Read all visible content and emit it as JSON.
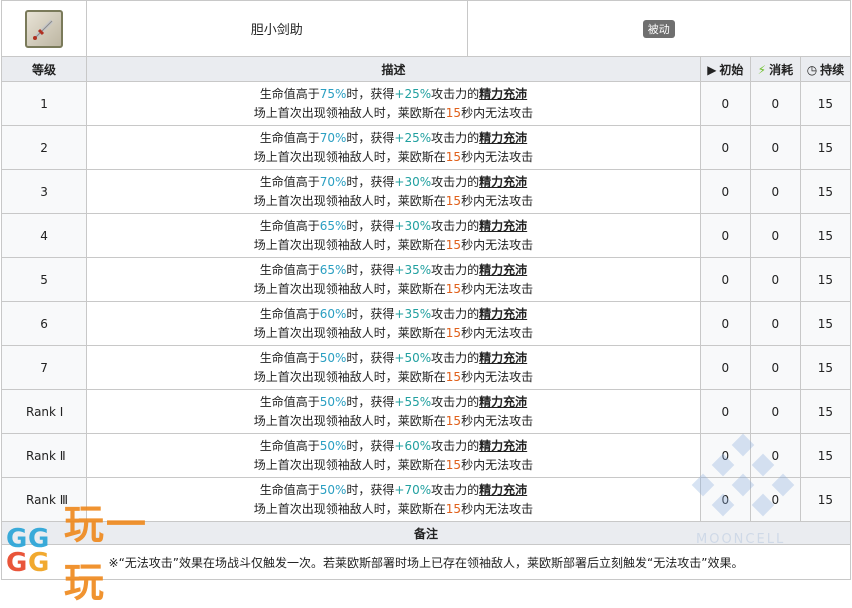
{
  "skill": {
    "name": "胆小剑助",
    "type_badge": "被动",
    "icon": "sword-skill-icon"
  },
  "columns": {
    "level": "等级",
    "description": "描述",
    "initial": "初始",
    "cost": "消耗",
    "duration": "持续"
  },
  "rows": [
    {
      "level": "1",
      "hp": "75%",
      "atk": "+25%",
      "initial": "0",
      "cost": "0",
      "duration": "15"
    },
    {
      "level": "2",
      "hp": "70%",
      "atk": "+25%",
      "initial": "0",
      "cost": "0",
      "duration": "15"
    },
    {
      "level": "3",
      "hp": "70%",
      "atk": "+30%",
      "initial": "0",
      "cost": "0",
      "duration": "15"
    },
    {
      "level": "4",
      "hp": "65%",
      "atk": "+30%",
      "initial": "0",
      "cost": "0",
      "duration": "15"
    },
    {
      "level": "5",
      "hp": "65%",
      "atk": "+35%",
      "initial": "0",
      "cost": "0",
      "duration": "15"
    },
    {
      "level": "6",
      "hp": "60%",
      "atk": "+35%",
      "initial": "0",
      "cost": "0",
      "duration": "15"
    },
    {
      "level": "7",
      "hp": "50%",
      "atk": "+50%",
      "initial": "0",
      "cost": "0",
      "duration": "15"
    },
    {
      "level": "Rank Ⅰ",
      "hp": "50%",
      "atk": "+55%",
      "initial": "0",
      "cost": "0",
      "duration": "15"
    },
    {
      "level": "Rank Ⅱ",
      "hp": "50%",
      "atk": "+60%",
      "initial": "0",
      "cost": "0",
      "duration": "15"
    },
    {
      "level": "Rank Ⅲ",
      "hp": "50%",
      "atk": "+70%",
      "initial": "0",
      "cost": "0",
      "duration": "15"
    }
  ],
  "desc_text": {
    "a": "生命值高于",
    "b": "时，获得",
    "c": "攻击力的",
    "buff": "精力充沛",
    "line2_a": "场上首次出现领袖敌人时，莱欧斯在",
    "seconds": "15",
    "line2_b": "秒内无法攻击"
  },
  "notes": {
    "header": "备注",
    "text": "※“无法攻击”效果在场战斗仅触发一次。若莱欧斯部署时场上已存在领袖敌人，莱欧斯部署后立刻触发“无法攻击”效果。"
  },
  "watermark": {
    "logo_letters": [
      "G",
      "G",
      "G",
      "G"
    ],
    "site_text": "玩一玩",
    "right_caption": "MOONCELL"
  },
  "colors": {
    "header_bg": "#eaecf0",
    "hp_color": "#2a9fc2",
    "atk_color": "#21a0a0",
    "seconds_color": "#e0601a"
  }
}
